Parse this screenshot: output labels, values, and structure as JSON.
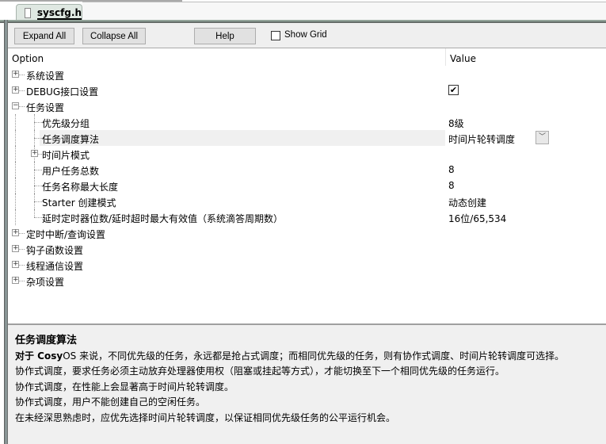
{
  "tab": {
    "label": "syscfg.h",
    "icon": "file-icon"
  },
  "toolbar": {
    "expand_all": "Expand All",
    "collapse_all": "Collapse All",
    "help": "Help",
    "show_grid": "Show Grid",
    "show_grid_checked": false
  },
  "tree": {
    "headers": {
      "option": "Option",
      "value": "Value"
    },
    "rows": [
      {
        "label": "系统设置",
        "level": 0,
        "expander": "+",
        "value": ""
      },
      {
        "label": "DEBUG接口设置",
        "level": 0,
        "expander": "+",
        "value": "",
        "checkbox": true
      },
      {
        "label": "任务设置",
        "level": 0,
        "expander": "-",
        "value": ""
      },
      {
        "label": "优先级分组",
        "level": 1,
        "value": "8级"
      },
      {
        "label": "任务调度算法",
        "level": 1,
        "value": "时间片轮转调度",
        "selected": true,
        "dropdown": true
      },
      {
        "label": "时间片模式",
        "level": 1,
        "expander": "+",
        "value": ""
      },
      {
        "label": "用户任务总数",
        "level": 1,
        "value": "8"
      },
      {
        "label": "任务名称最大长度",
        "level": 1,
        "value": "8"
      },
      {
        "label": "Starter 创建模式",
        "level": 1,
        "value": "动态创建"
      },
      {
        "label": "延时定时器位数/延时超时最大有效值（系统滴答周期数）",
        "level": 1,
        "value": "16位/65,534"
      },
      {
        "label": "定时中断/查询设置",
        "level": 0,
        "expander": "+",
        "value": ""
      },
      {
        "label": "钩子函数设置",
        "level": 0,
        "expander": "+",
        "value": ""
      },
      {
        "label": "线程通信设置",
        "level": 0,
        "expander": "+",
        "value": ""
      },
      {
        "label": "杂项设置",
        "level": 0,
        "expander": "+",
        "value": ""
      }
    ]
  },
  "description": {
    "title": "任务调度算法",
    "lead_bold": "对于 Cosy",
    "lines": [
      "OS 来说，不同优先级的任务，永远都是抢占式调度；而相同优先级的任务，则有协作式调度、时间片轮转调度可选择。",
      "协作式调度，要求任务必须主动放弃处理器使用权（阻塞或挂起等方式），才能切换至下一个相同优先级的任务运行。",
      "协作式调度，在性能上会显著高于时间片轮转调度。",
      "协作式调度，用户不能创建自己的空闲任务。",
      "在未经深思熟虑时，应优先选择时间片轮转调度，以保证相同优先级任务的公平运行机会。"
    ]
  }
}
